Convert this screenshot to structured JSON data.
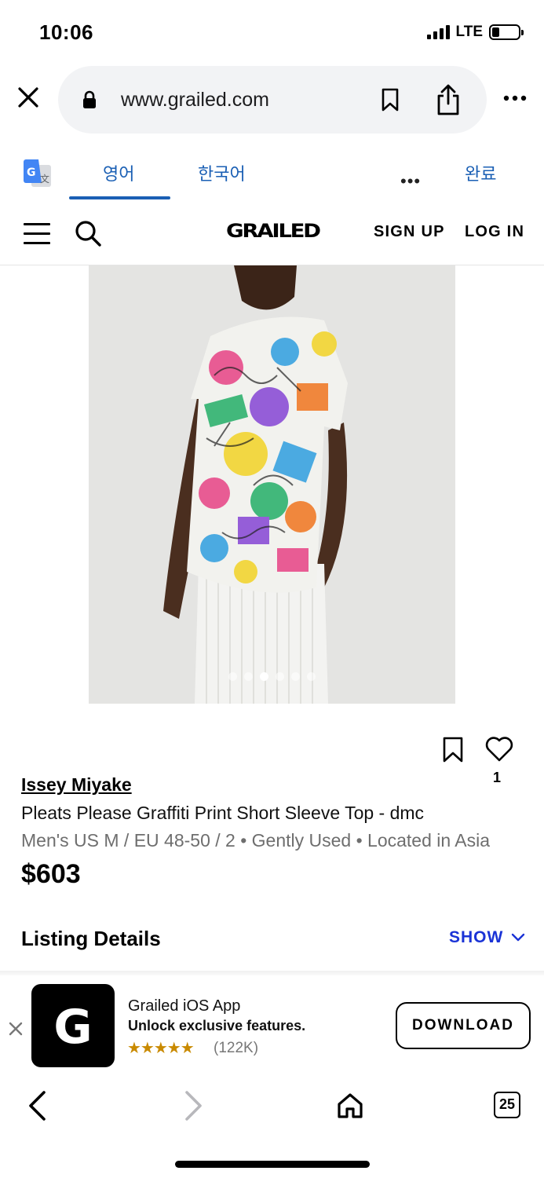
{
  "status_bar": {
    "time": "10:06",
    "network": "LTE"
  },
  "browser": {
    "url": "www.grailed.com",
    "tab_count": "25"
  },
  "translate_bar": {
    "source_lang": "영어",
    "target_lang": "한국어",
    "more": "•••",
    "done": "완료"
  },
  "site_header": {
    "logo": "GRAILED",
    "sign_up": "SIGN UP",
    "log_in": "LOG IN"
  },
  "carousel": {
    "total_images": 6,
    "active_index": 2
  },
  "product": {
    "designer": "Issey Miyake",
    "title": "Pleats Please Graffiti Print Short Sleeve Top - dmc",
    "meta": "Men's US M / EU 48-50 / 2 • Gently Used • Located in Asia",
    "price": "$603",
    "like_count": "1"
  },
  "listing_details": {
    "label": "Listing Details",
    "toggle": "SHOW"
  },
  "app_banner": {
    "icon_letter": "G",
    "name": "Grailed iOS App",
    "tagline": "Unlock exclusive features.",
    "stars": "★★★★★",
    "rating_count": "(122K)",
    "cta": "DOWNLOAD"
  },
  "colors": {
    "link_blue": "#1a5fb4",
    "show_blue": "#1a33d6",
    "star_gold": "#c98a00"
  }
}
